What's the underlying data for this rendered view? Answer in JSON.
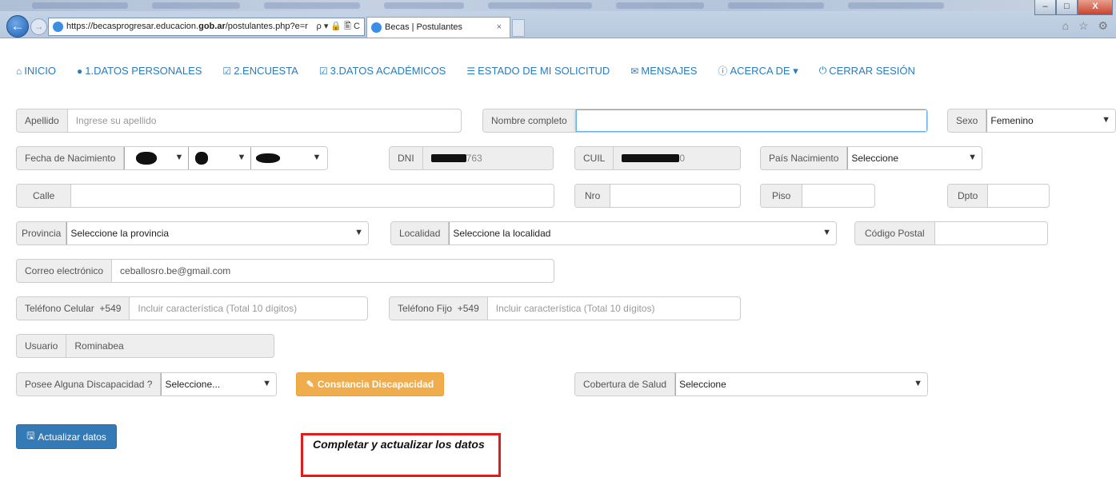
{
  "browser": {
    "url_prefix": "https://becasprogresar.educacion.",
    "url_domain": "gob.ar",
    "url_suffix": "/postulantes.php?e=r",
    "address_controls": "ρ ▾ 🔒 🖺 C",
    "tab_title": "Becas | Postulantes",
    "tab_close": "×",
    "window_buttons": [
      "–",
      "□",
      "X"
    ],
    "right_icons": "⌂ ☆ ⚙"
  },
  "nav": [
    {
      "icon": "home-icon",
      "glyph": "⌂",
      "label": "INICIO"
    },
    {
      "icon": "user-icon",
      "glyph": "●",
      "label": "1.DATOS PERSONALES"
    },
    {
      "icon": "edit-icon",
      "glyph": "☑",
      "label": "2.ENCUESTA"
    },
    {
      "icon": "edit-icon",
      "glyph": "☑",
      "label": "3.DATOS ACADÉMICOS"
    },
    {
      "icon": "list-icon",
      "glyph": "☰",
      "label": "ESTADO DE MI SOLICITUD"
    },
    {
      "icon": "comment-icon",
      "glyph": "✉",
      "label": "MENSAJES"
    },
    {
      "icon": "info-icon",
      "glyph": "ⓘ",
      "label": "ACERCA DE ▾"
    },
    {
      "icon": "power-icon",
      "glyph": "⏻",
      "label": "CERRAR SESIÓN"
    }
  ],
  "form": {
    "apellido": {
      "label": "Apellido",
      "placeholder": "Ingrese su apellido"
    },
    "nombre": {
      "label": "Nombre completo",
      "value": ""
    },
    "sexo": {
      "label": "Sexo",
      "value": "Femenino"
    },
    "fecha_nacimiento": {
      "label": "Fecha de Nacimiento"
    },
    "dni": {
      "label": "DNI",
      "value_suffix": "763"
    },
    "cuil": {
      "label": "CUIL",
      "value_suffix": "0"
    },
    "pais": {
      "label": "País Nacimiento",
      "value": "Seleccione"
    },
    "calle": {
      "label": "Calle",
      "value": ""
    },
    "nro": {
      "label": "Nro",
      "value": ""
    },
    "piso": {
      "label": "Piso",
      "value": ""
    },
    "dpto": {
      "label": "Dpto",
      "value": ""
    },
    "provincia": {
      "label": "Provincia",
      "value": "Seleccione la provincia"
    },
    "localidad": {
      "label": "Localidad",
      "value": "Seleccione la localidad"
    },
    "codigo_postal": {
      "label": "Código Postal",
      "value": ""
    },
    "correo": {
      "label": "Correo electrónico",
      "value": "ceballosro.be@gmail.com"
    },
    "tel_celular": {
      "label": "Teléfono Celular",
      "prefix": "+549",
      "placeholder": "Incluir característica (Total 10 dígitos)"
    },
    "tel_fijo": {
      "label": "Teléfono Fijo",
      "prefix": "+549",
      "placeholder": "Incluir característica (Total 10 dígitos)"
    },
    "usuario": {
      "label": "Usuario",
      "value": "Rominabea"
    },
    "discapacidad": {
      "label": "Posee Alguna Discapacidad ?",
      "value": "Seleccione..."
    },
    "cobertura": {
      "label": "Cobertura de Salud",
      "value": "Seleccione"
    }
  },
  "buttons": {
    "constancia": "Constancia Discapacidad",
    "actualizar": "Actualizar datos"
  },
  "annotation": "Completar y actualizar los datos",
  "colors": {
    "link": "#2a7bbf",
    "primary": "#337ab7",
    "warning": "#f0ad4e",
    "annotation_border": "#e01d1d"
  }
}
